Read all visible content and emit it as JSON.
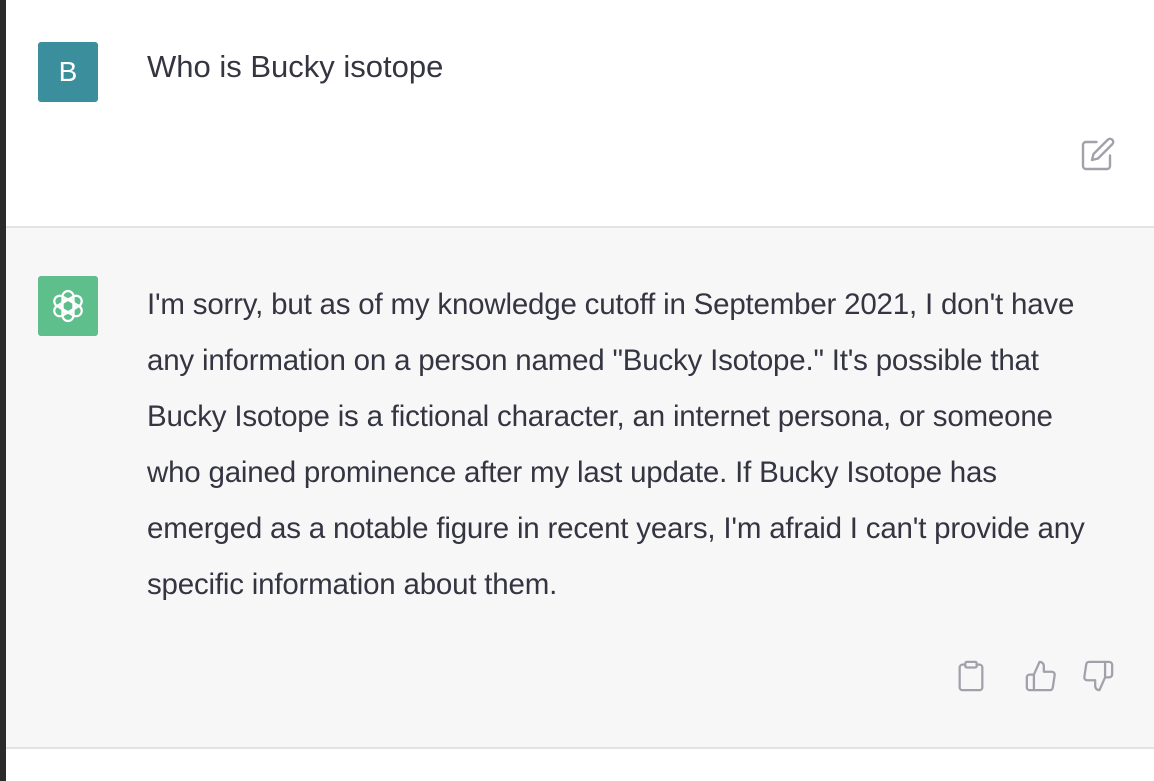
{
  "user_message": {
    "avatar_letter": "B",
    "avatar_color": "#3b8e9b",
    "text": "Who is Bucky isotope",
    "edit_icon": "pencil-square-icon"
  },
  "assistant_message": {
    "avatar_icon": "openai-logo-icon",
    "avatar_color": "#5ebf8c",
    "text": "I'm sorry, but as of my knowledge cutoff in September 2021, I don't have any information on a person named \"Bucky Isotope.\" It's possible that Bucky Isotope is a fictional character, an internet persona, or someone who gained prominence after my last update. If Bucky Isotope has emerged as a notable figure in recent years, I'm afraid I can't provide any specific information about them.",
    "actions": {
      "copy_icon": "clipboard-icon",
      "thumbs_up_icon": "thumbs-up-icon",
      "thumbs_down_icon": "thumbs-down-icon"
    }
  },
  "colors": {
    "text": "#343541",
    "assistant_bg": "#f7f7f8",
    "icon": "#a1a1aa"
  }
}
